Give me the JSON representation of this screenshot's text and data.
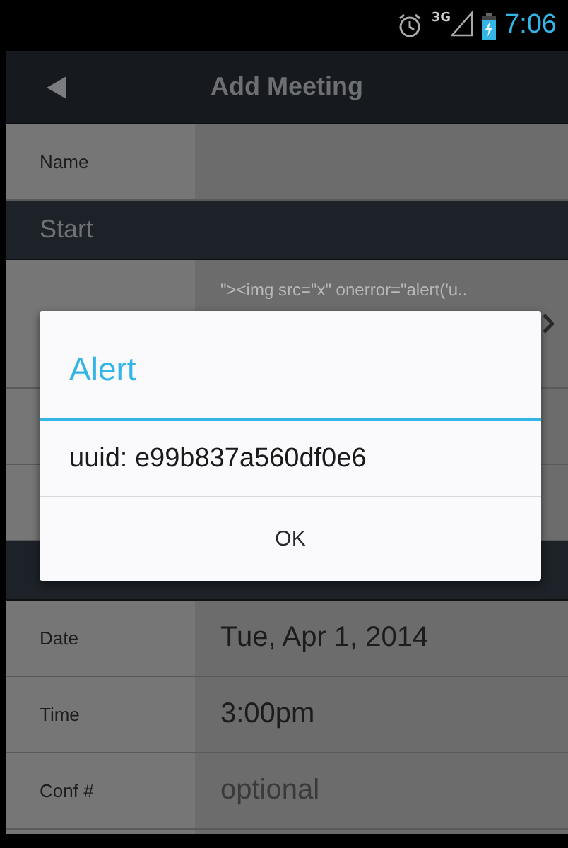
{
  "status_bar": {
    "time": "7:06",
    "network": "3G"
  },
  "action_bar": {
    "title": "Add Meeting"
  },
  "items": [
    {
      "kind": "field",
      "label": "Name"
    },
    {
      "kind": "header",
      "title": "Start"
    },
    {
      "kind": "picker",
      "value": "\"><img src=\"x\" onerror=\"alert('u.."
    },
    {
      "kind": "blank"
    },
    {
      "kind": "blank"
    },
    {
      "kind": "header"
    },
    {
      "kind": "field",
      "label": "Date",
      "value": "Tue, Apr 1, 2014"
    },
    {
      "kind": "field",
      "label": "Time",
      "value": "3:00pm"
    },
    {
      "kind": "field",
      "label": "Conf #",
      "placeholder": "optional"
    },
    {
      "kind": "blank"
    }
  ],
  "dialog": {
    "title": "Alert",
    "message": "uuid: e99b837a560df0e6",
    "buttons": [
      "OK"
    ]
  }
}
